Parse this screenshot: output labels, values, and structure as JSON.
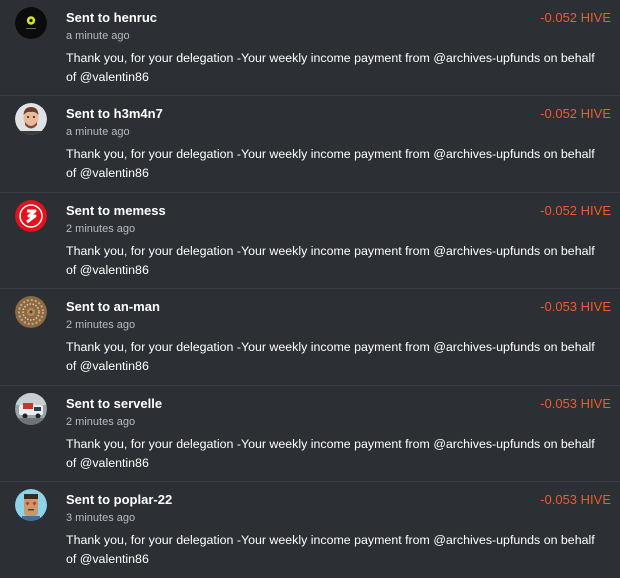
{
  "transactions": [
    {
      "title": "Sent to henruc",
      "time": "a minute ago",
      "amount": "-0.052 HIVE",
      "memo": "Thank you, for your delegation -Your weekly income payment from @archives-upfunds on behalf of @valentin86",
      "avatar_icon": "henruc-avatar-icon"
    },
    {
      "title": "Sent to h3m4n7",
      "time": "a minute ago",
      "amount": "-0.052 HIVE",
      "memo": "Thank you, for your delegation -Your weekly income payment from @archives-upfunds on behalf of @valentin86",
      "avatar_icon": "h3m4n7-avatar-icon"
    },
    {
      "title": "Sent to memess",
      "time": "2 minutes ago",
      "amount": "-0.052 HIVE",
      "memo": "Thank you, for your delegation -Your weekly income payment from @archives-upfunds on behalf of @valentin86",
      "avatar_icon": "memess-avatar-icon"
    },
    {
      "title": "Sent to an-man",
      "time": "2 minutes ago",
      "amount": "-0.053 HIVE",
      "memo": "Thank you, for your delegation -Your weekly income payment from @archives-upfunds on behalf of @valentin86",
      "avatar_icon": "an-man-avatar-icon"
    },
    {
      "title": "Sent to servelle",
      "time": "2 minutes ago",
      "amount": "-0.053 HIVE",
      "memo": "Thank you, for your delegation -Your weekly income payment from @archives-upfunds on behalf of @valentin86",
      "avatar_icon": "servelle-avatar-icon"
    },
    {
      "title": "Sent to poplar-22",
      "time": "3 minutes ago",
      "amount": "-0.053 HIVE",
      "memo": "Thank you, for your delegation -Your weekly income payment from @archives-upfunds on behalf of @valentin86",
      "avatar_icon": "poplar-22-avatar-icon"
    }
  ],
  "colors": {
    "background": "#2c2f33",
    "amount": "#ef5a2f",
    "muted_text": "#b9bbbe"
  }
}
